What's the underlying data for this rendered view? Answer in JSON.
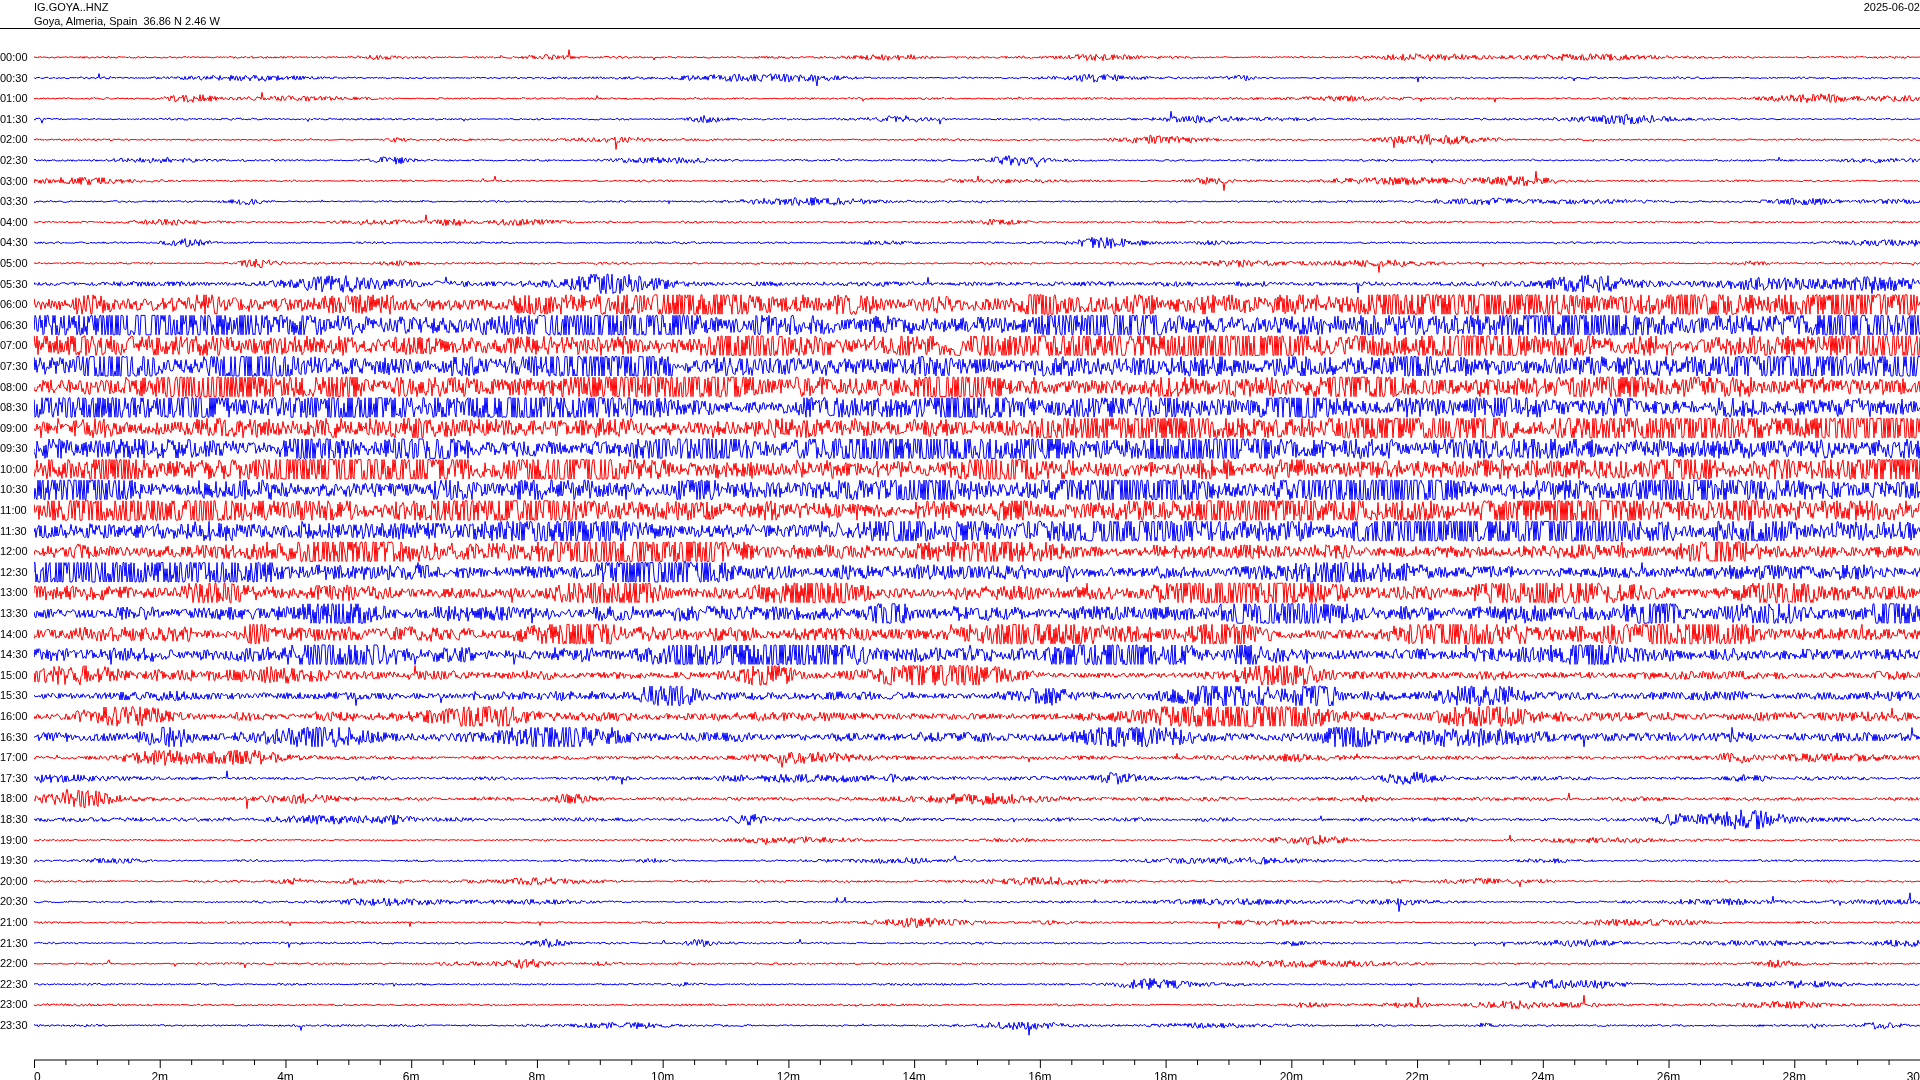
{
  "header": {
    "station": "IG.GOYA..HNZ",
    "location": "Goya, Almeria, Spain  36.86 N 2.46 W",
    "date": "2025-06-02"
  },
  "helicorder": {
    "traces": [
      {
        "time": "00:00",
        "color": "#ff0000"
      },
      {
        "time": "00:30",
        "color": "#0000ff"
      },
      {
        "time": "01:00",
        "color": "#ff0000"
      },
      {
        "time": "01:30",
        "color": "#0000ff"
      },
      {
        "time": "02:00",
        "color": "#ff0000"
      },
      {
        "time": "02:30",
        "color": "#0000ff"
      },
      {
        "time": "03:00",
        "color": "#ff0000"
      },
      {
        "time": "03:30",
        "color": "#0000ff"
      },
      {
        "time": "04:00",
        "color": "#ff0000"
      },
      {
        "time": "04:30",
        "color": "#0000ff"
      },
      {
        "time": "05:00",
        "color": "#ff0000"
      },
      {
        "time": "05:30",
        "color": "#0000ff"
      },
      {
        "time": "06:00",
        "color": "#ff0000"
      },
      {
        "time": "06:30",
        "color": "#0000ff"
      },
      {
        "time": "07:00",
        "color": "#ff0000"
      },
      {
        "time": "07:30",
        "color": "#0000ff"
      },
      {
        "time": "08:00",
        "color": "#ff0000"
      },
      {
        "time": "08:30",
        "color": "#0000ff"
      },
      {
        "time": "09:00",
        "color": "#ff0000"
      },
      {
        "time": "09:30",
        "color": "#0000ff"
      },
      {
        "time": "10:00",
        "color": "#ff0000"
      },
      {
        "time": "10:30",
        "color": "#0000ff"
      },
      {
        "time": "11:00",
        "color": "#ff0000"
      },
      {
        "time": "11:30",
        "color": "#0000ff"
      },
      {
        "time": "12:00",
        "color": "#ff0000"
      },
      {
        "time": "12:30",
        "color": "#0000ff"
      },
      {
        "time": "13:00",
        "color": "#ff0000"
      },
      {
        "time": "13:30",
        "color": "#0000ff"
      },
      {
        "time": "14:00",
        "color": "#ff0000"
      },
      {
        "time": "14:30",
        "color": "#0000ff"
      },
      {
        "time": "15:00",
        "color": "#ff0000"
      },
      {
        "time": "15:30",
        "color": "#0000ff"
      },
      {
        "time": "16:00",
        "color": "#ff0000"
      },
      {
        "time": "16:30",
        "color": "#0000ff"
      },
      {
        "time": "17:00",
        "color": "#ff0000"
      },
      {
        "time": "17:30",
        "color": "#0000ff"
      },
      {
        "time": "18:00",
        "color": "#ff0000"
      },
      {
        "time": "18:30",
        "color": "#0000ff"
      },
      {
        "time": "19:00",
        "color": "#ff0000"
      },
      {
        "time": "19:30",
        "color": "#0000ff"
      },
      {
        "time": "20:00",
        "color": "#ff0000"
      },
      {
        "time": "20:30",
        "color": "#0000ff"
      },
      {
        "time": "21:00",
        "color": "#ff0000"
      },
      {
        "time": "21:30",
        "color": "#0000ff"
      },
      {
        "time": "22:00",
        "color": "#ff0000"
      },
      {
        "time": "22:30",
        "color": "#0000ff"
      },
      {
        "time": "23:00",
        "color": "#ff0000"
      },
      {
        "time": "23:30",
        "color": "#0000ff"
      }
    ],
    "x_axis": {
      "ticks": [
        "0",
        "2m",
        "4m",
        "6m",
        "8m",
        "10m",
        "12m",
        "14m",
        "16m",
        "18m",
        "20m",
        "22m",
        "24m",
        "26m",
        "28m",
        "30"
      ]
    }
  }
}
